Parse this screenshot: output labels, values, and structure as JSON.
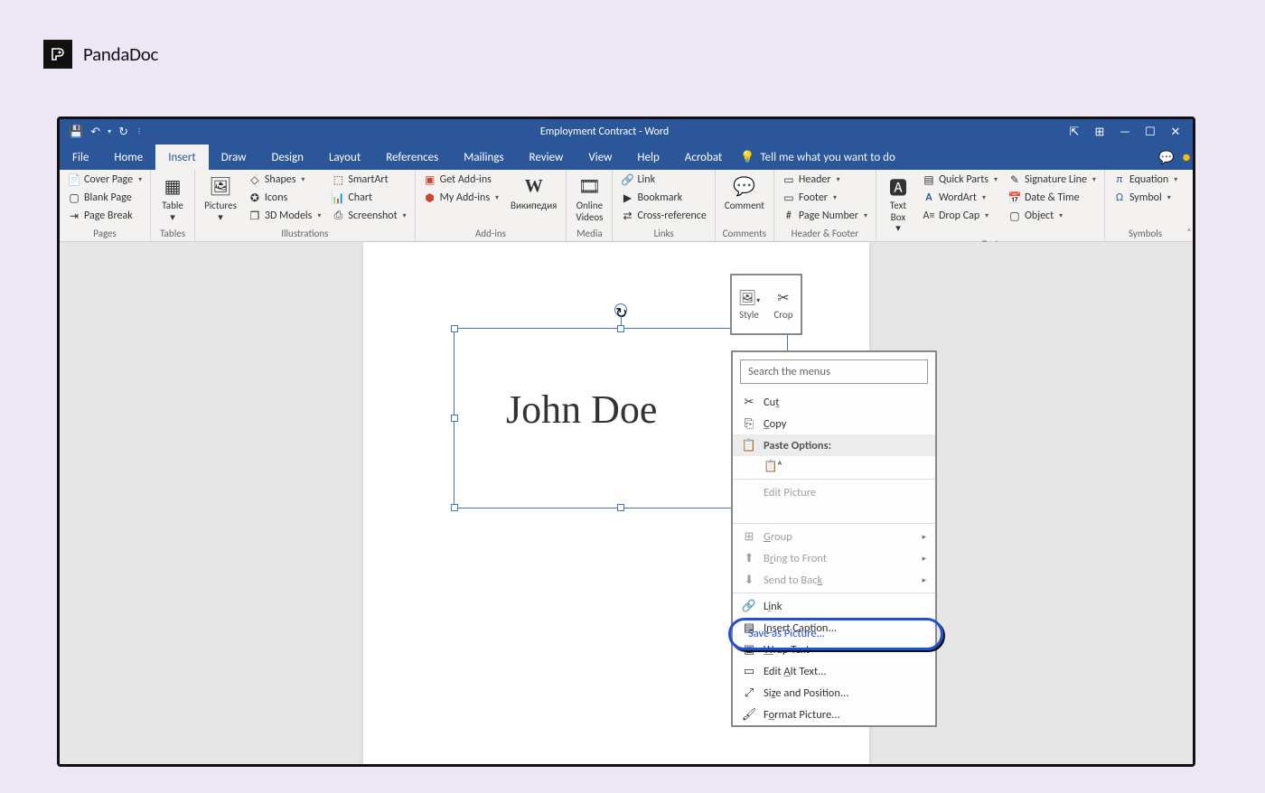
{
  "brand": {
    "name": "PandaDoc"
  },
  "title": "Employment Contract - Word",
  "tabs": [
    "File",
    "Home",
    "Insert",
    "Draw",
    "Design",
    "Layout",
    "References",
    "Mailings",
    "Review",
    "View",
    "Help",
    "Acrobat"
  ],
  "activeTab": "Insert",
  "tellMe": "Tell me what you want to do",
  "ribbon": {
    "pages": {
      "label": "Pages",
      "cover": "Cover Page",
      "blank": "Blank Page",
      "break": "Page Break"
    },
    "tables": {
      "label": "Tables",
      "table": "Table"
    },
    "illustrations": {
      "label": "Illustrations",
      "pictures": "Pictures",
      "shapes": "Shapes",
      "icons": "Icons",
      "models": "3D Models",
      "smartart": "SmartArt",
      "chart": "Chart",
      "screenshot": "Screenshot"
    },
    "addins": {
      "label": "Add-ins",
      "get": "Get Add-ins",
      "my": "My Add-ins",
      "wiki": "Википедия"
    },
    "media": {
      "label": "Media",
      "video": "Online Videos"
    },
    "links": {
      "label": "Links",
      "link": "Link",
      "bookmark": "Bookmark",
      "crossref": "Cross-reference"
    },
    "comments": {
      "label": "Comments",
      "comment": "Comment"
    },
    "headerfooter": {
      "label": "Header & Footer",
      "header": "Header",
      "footer": "Footer",
      "pagenum": "Page Number"
    },
    "text": {
      "label": "Text",
      "textbox": "Text Box",
      "quickparts": "Quick Parts",
      "wordart": "WordArt",
      "dropcap": "Drop Cap",
      "sigline": "Signature Line",
      "datetime": "Date & Time",
      "object": "Object"
    },
    "symbols": {
      "label": "Symbols",
      "equation": "Equation",
      "symbol": "Symbol"
    }
  },
  "signature": "John Doe",
  "miniToolbar": {
    "style": "Style",
    "crop": "Crop"
  },
  "context": {
    "search": "Search the menus",
    "cut": "Cut",
    "copy": "Copy",
    "pasteOptions": "Paste Options:",
    "editPicture": "Edit Picture",
    "saveAsPicture": "Save as Picture...",
    "group": "Group",
    "bringFront": "Bring to Front",
    "sendBack": "Send to Back",
    "link": "Link",
    "insertCaption": "Insert Caption...",
    "wrapText": "Wrap Text",
    "editAlt": "Edit Alt Text...",
    "sizePos": "Size and Position...",
    "formatPicture": "Format Picture..."
  }
}
